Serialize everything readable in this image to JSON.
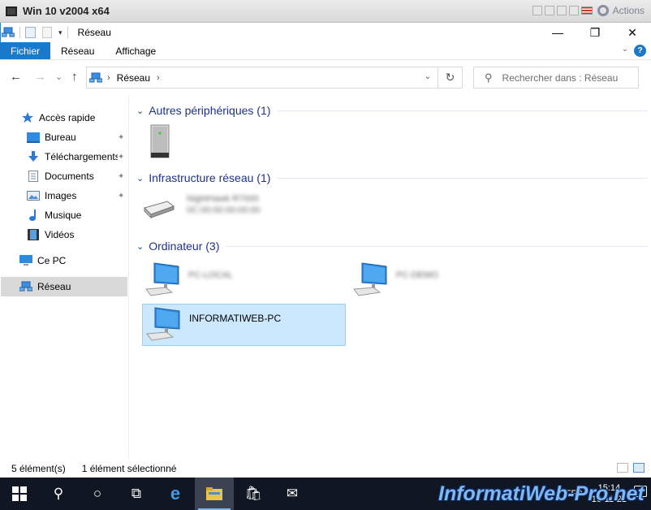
{
  "host_window": {
    "title": "Win 10 v2004 x64",
    "actions_label": "Actions"
  },
  "title_bar": {
    "title": "Réseau",
    "minimize_glyph": "—",
    "maximize_glyph": "❐",
    "close_glyph": "✕",
    "dropdown_glyph": "▾"
  },
  "ribbon": {
    "tabs": [
      {
        "label": "Fichier",
        "active": true
      },
      {
        "label": "Réseau",
        "active": false
      },
      {
        "label": "Affichage",
        "active": false
      }
    ],
    "expand_glyph": "⌄",
    "help_glyph": "?"
  },
  "address_bar": {
    "back_glyph": "←",
    "forward_glyph": "→",
    "recent_glyph": "⌄",
    "up_glyph": "↑",
    "separator_glyph": "›",
    "crumb": "Réseau",
    "dropdown_glyph": "⌄",
    "refresh_glyph": "↻"
  },
  "search": {
    "icon_glyph": "⚲",
    "placeholder": "Rechercher dans : Réseau"
  },
  "sidebar": {
    "quick_access": "Accès rapide",
    "items": [
      {
        "label": "Bureau",
        "icon": "desktop-icon",
        "pinned": true
      },
      {
        "label": "Téléchargements",
        "icon": "download-icon",
        "pinned": true
      },
      {
        "label": "Documents",
        "icon": "document-icon",
        "pinned": true
      },
      {
        "label": "Images",
        "icon": "pictures-icon",
        "pinned": true
      },
      {
        "label": "Musique",
        "icon": "music-icon",
        "pinned": false
      },
      {
        "label": "Vidéos",
        "icon": "videos-icon",
        "pinned": false
      }
    ],
    "this_pc": "Ce PC",
    "network": "Réseau",
    "pin_glyph": "📌"
  },
  "groups": [
    {
      "title": "Autres périphériques (1)",
      "chevron": "⌄"
    },
    {
      "title": "Infrastructure réseau (1)",
      "chevron": "⌄"
    },
    {
      "title": "Ordinateur (3)",
      "chevron": "⌄"
    }
  ],
  "devices": {
    "router_line1": "NightHawk R7000",
    "router_line2": "0C:00:00:00:00:00",
    "computer1": "PC-LOCAL",
    "computer2": "PC-DEMO",
    "computer3": "INFORMATIWEB-PC"
  },
  "status_bar": {
    "count": "5 élément(s)",
    "selection": "1 élément sélectionné"
  },
  "taskbar": {
    "start_glyph": "⊞",
    "search_glyph": "⚲",
    "cortana_glyph": "○",
    "taskview_glyph": "⧉",
    "edge_glyph": "e",
    "explorer_glyph": "▬",
    "store_glyph": "🛍",
    "mail_glyph": "✉",
    "language": "FRA",
    "time": "15:14",
    "date": "16-11-21"
  },
  "watermark": "InformatiWeb-Pro.net",
  "colors": {
    "accent": "#1979ca",
    "group_title": "#1e3287",
    "selection": "#cce8ff",
    "taskbar": "#101722"
  }
}
